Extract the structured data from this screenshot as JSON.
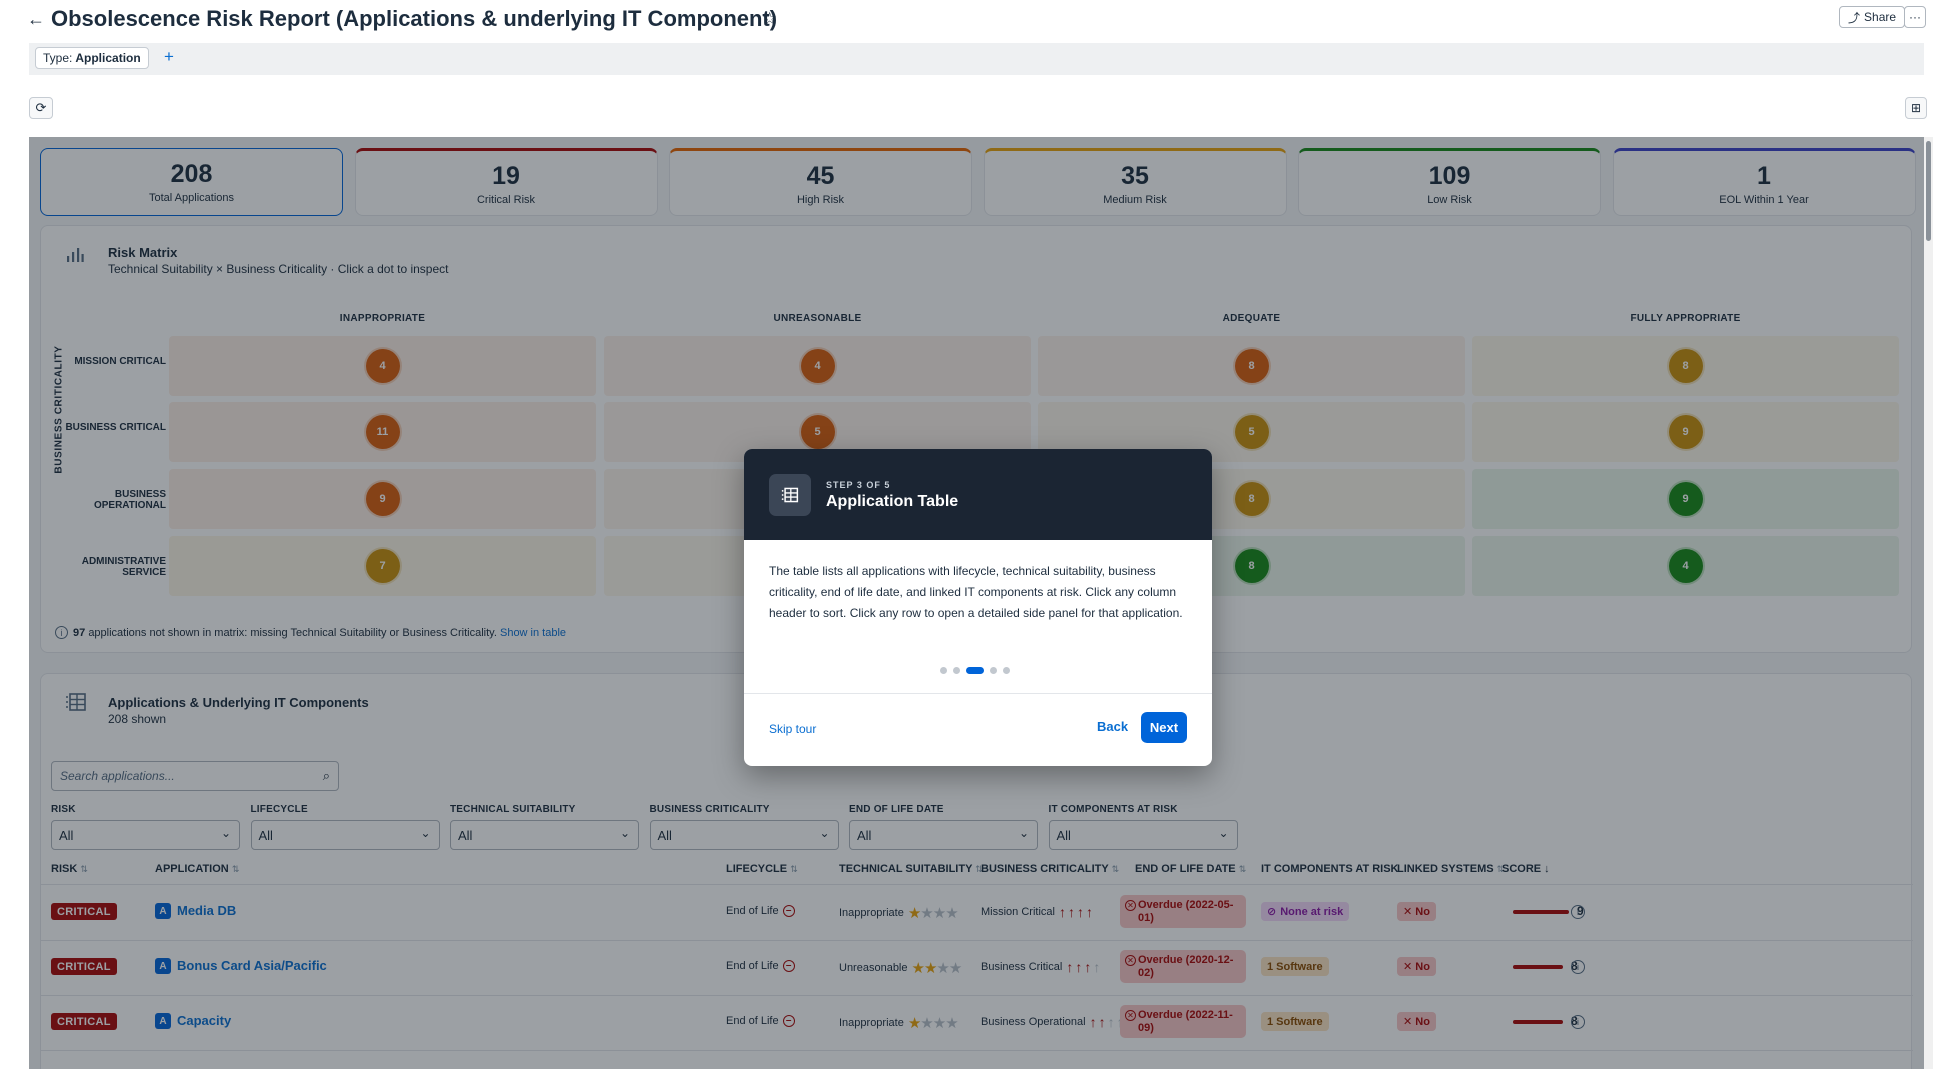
{
  "header": {
    "title": "Obsolescence Risk Report (Applications & underlying IT Component)",
    "share_label": "Share",
    "back_icon": "arrow-left-icon",
    "favorite_icon": "star-outline-icon"
  },
  "filter": {
    "chip_key": "Type:",
    "chip_value": "Application",
    "add_symbol": "+"
  },
  "kpis": [
    {
      "value": "208",
      "label": "Total Applications",
      "color": "#0064d9"
    },
    {
      "value": "19",
      "label": "Critical Risk",
      "color": "#aa0808"
    },
    {
      "value": "45",
      "label": "High Risk",
      "color": "#e76500"
    },
    {
      "value": "35",
      "label": "Medium Risk",
      "color": "#e9a20b"
    },
    {
      "value": "109",
      "label": "Low Risk",
      "color": "#188918"
    },
    {
      "value": "1",
      "label": "EOL Within 1 Year",
      "color": "#3c41c8"
    }
  ],
  "matrix": {
    "title": "Risk Matrix",
    "subtitle": "Technical Suitability × Business Criticality · Click a dot to inspect",
    "y_axis_label": "BUSINESS CRITICALITY",
    "columns": [
      "INAPPROPRIATE",
      "UNREASONABLE",
      "ADEQUATE",
      "FULLY APPROPRIATE"
    ],
    "rows": [
      {
        "label": "MISSION CRITICAL",
        "counts": [
          "4",
          "4",
          "8",
          "8"
        ]
      },
      {
        "label": "BUSINESS CRITICAL",
        "counts": [
          "11",
          "5",
          "5",
          "9"
        ]
      },
      {
        "label": "BUSINESS OPERATIONAL",
        "counts": [
          "9",
          "",
          "8",
          "9"
        ]
      },
      {
        "label": "ADMINISTRATIVE SERVICE",
        "counts": [
          "7",
          "",
          "8",
          "4"
        ]
      }
    ],
    "note_count": "97",
    "note_text": "applications not shown in matrix: missing Technical Suitability or Business Criticality.",
    "note_link": "Show in table"
  },
  "table_card": {
    "title": "Applications & Underlying IT Components",
    "subtitle": "208 shown",
    "search_placeholder": "Search applications...",
    "filters": [
      {
        "label": "RISK",
        "value": "All"
      },
      {
        "label": "LIFECYCLE",
        "value": "All"
      },
      {
        "label": "TECHNICAL SUITABILITY",
        "value": "All"
      },
      {
        "label": "BUSINESS CRITICALITY",
        "value": "All"
      },
      {
        "label": "END OF LIFE DATE",
        "value": "All"
      },
      {
        "label": "IT COMPONENTS AT RISK",
        "value": "All"
      }
    ],
    "headers": {
      "risk": "RISK",
      "application": "APPLICATION",
      "lifecycle": "LIFECYCLE",
      "tech": "TECHNICAL SUITABILITY",
      "crit": "BUSINESS CRITICALITY",
      "eol": "END OF LIFE DATE",
      "components": "IT COMPONENTS AT RISK",
      "linked": "LINKED SYSTEMS",
      "score": "SCORE ↓"
    },
    "rows": [
      {
        "risk": "CRITICAL",
        "badge": "A",
        "name": "Media DB",
        "lifecycle": "End of Life",
        "tech": "Inappropriate",
        "tech_stars": 1,
        "crit": "Mission Critical",
        "crit_level": 4,
        "eol_line1": "Overdue (2022-05-",
        "eol_line2": "01)",
        "components": "None at risk",
        "linked": "✕ No",
        "score": "9",
        "score_fraction": 0.9
      },
      {
        "risk": "CRITICAL",
        "badge": "A",
        "name": "Bonus Card Asia/Pacific",
        "lifecycle": "End of Life",
        "tech": "Unreasonable",
        "tech_stars": 2,
        "crit": "Business Critical",
        "crit_level": 3,
        "eol_line1": "Overdue (2020-12-",
        "eol_line2": "02)",
        "components": "1 Software",
        "linked": "✕ No",
        "score": "8",
        "score_fraction": 0.8
      },
      {
        "risk": "CRITICAL",
        "badge": "A",
        "name": "Capacity",
        "lifecycle": "End of Life",
        "tech": "Inappropriate",
        "tech_stars": 1,
        "crit": "Business Operational",
        "crit_level": 2,
        "eol_line1": "Overdue (2022-11-",
        "eol_line2": "09)",
        "components": "1 Software",
        "linked": "✕ No",
        "score": "8",
        "score_fraction": 0.8
      }
    ]
  },
  "tour": {
    "step": "STEP 3 OF 5",
    "title": "Application Table",
    "body": "The table lists all applications with lifecycle, technical suitability, business criticality, end of life date, and linked IT components at risk. Click any column header to sort. Click any row to open a detailed side panel for that application.",
    "total_steps": 5,
    "current_step": 3,
    "skip_label": "Skip tour",
    "back_label": "Back",
    "next_label": "Next"
  },
  "colors": {
    "critical": "#aa0808",
    "high": "#e76500",
    "medium": "#e9a20b",
    "low": "#188918",
    "accent": "#0064d9"
  }
}
